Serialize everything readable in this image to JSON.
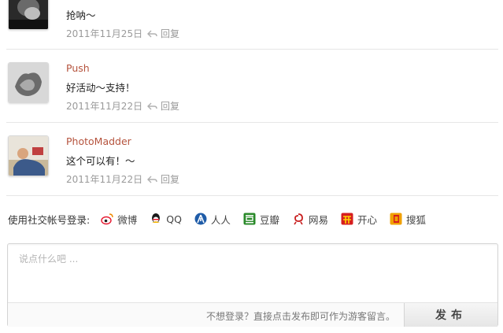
{
  "comments": [
    {
      "author": "",
      "text": "抢呐～",
      "date": "2011年11月25日",
      "reply": "回复"
    },
    {
      "author": "Push",
      "text": "好活动～支持！",
      "date": "2011年11月22日",
      "reply": "回复"
    },
    {
      "author": "PhotoMadder",
      "text": "这个可以有！～",
      "date": "2011年11月22日",
      "reply": "回复"
    }
  ],
  "social": {
    "label": "使用社交帐号登录:",
    "providers": [
      {
        "name": "微博",
        "icon": "weibo-icon",
        "color": "#e6162d"
      },
      {
        "name": "QQ",
        "icon": "qq-icon",
        "color": "#1a1a1a"
      },
      {
        "name": "人人",
        "icon": "renren-icon",
        "color": "#1f5ca8"
      },
      {
        "name": "豆瓣",
        "icon": "douban-icon",
        "color": "#2a8a2a"
      },
      {
        "name": "网易",
        "icon": "netease-icon",
        "color": "#c81e1e"
      },
      {
        "name": "开心",
        "icon": "kaixin-icon",
        "color": "#d61e1e"
      },
      {
        "name": "搜狐",
        "icon": "sohu-icon",
        "color": "#f0a000"
      }
    ]
  },
  "composer": {
    "placeholder": "说点什么吧 ...",
    "hint": "不想登录？直接点击发布即可作为游客留言。",
    "submit": "发布"
  }
}
